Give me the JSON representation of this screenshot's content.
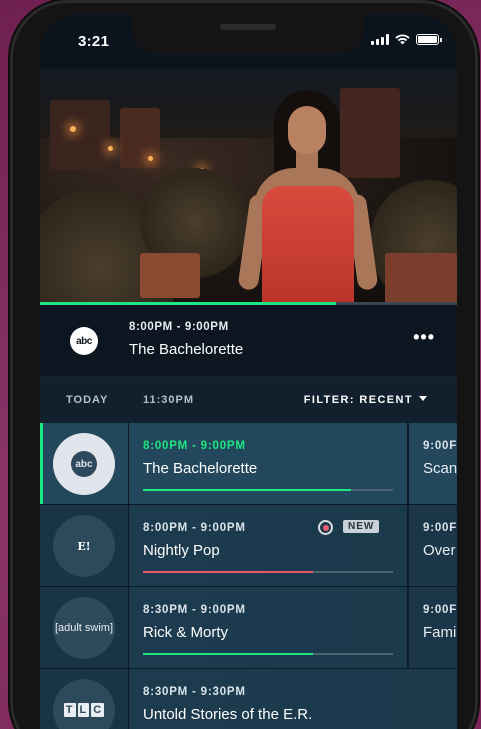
{
  "status_bar": {
    "time": "3:21"
  },
  "player": {
    "progress": 0.71
  },
  "now_playing": {
    "network": "abc",
    "time": "8:00PM - 9:00PM",
    "title": "The Bachelorette",
    "more_icon": "more-icon"
  },
  "guide_header": {
    "today": "TODAY",
    "current_time": "11:30PM",
    "filter": "FILTER: RECENT"
  },
  "rows": [
    {
      "network": "abc",
      "time": "8:00PM - 9:00PM",
      "title": "The Bachelorette",
      "progress": 0.83,
      "progress_color": "#1ce783",
      "active": true,
      "next_time": "9:00F",
      "next_title": "Scan"
    },
    {
      "network": "E!",
      "time": "8:00PM - 9:00PM",
      "title": "Nightly Pop",
      "progress": 0.68,
      "progress_color": "#e85a6a",
      "badge": "NEW",
      "next_time": "9:00F",
      "next_title": "Over"
    },
    {
      "network": "[adult swim]",
      "time": "8:30PM - 9:00PM",
      "title": "Rick & Morty",
      "progress": 0.68,
      "progress_color": "#1ce783",
      "next_time": "9:00F",
      "next_title": "Fami"
    },
    {
      "network": "TLC",
      "time": "8:30PM - 9:30PM",
      "title": "Untold Stories of the E.R.",
      "progress": 0,
      "progress_color": "#1ce783"
    }
  ]
}
